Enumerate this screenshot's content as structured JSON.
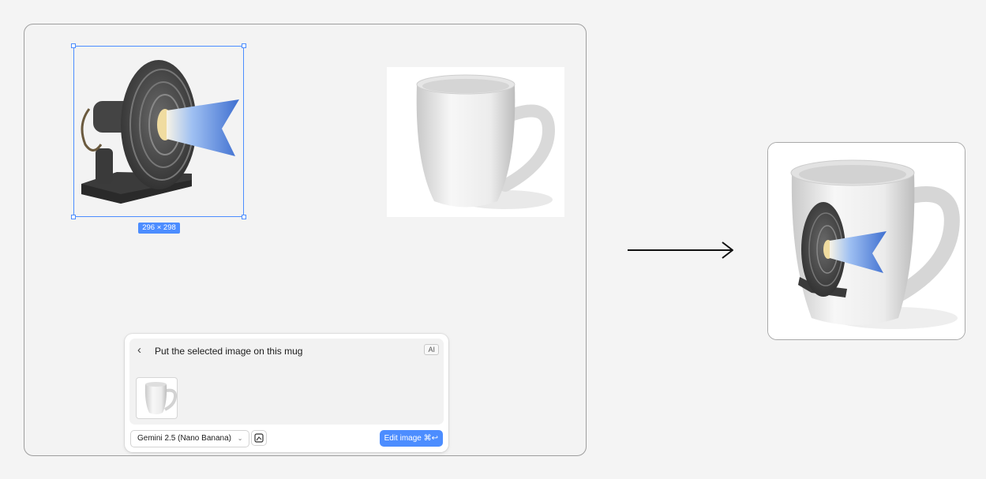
{
  "canvas": {
    "selected_image": {
      "icon": "projector-lens-icon",
      "size_label": "296 × 298"
    },
    "mug_image": {
      "icon": "white-mug-icon"
    }
  },
  "prompt_panel": {
    "back_icon": "chevron-left-icon",
    "back_glyph": "‹",
    "prompt": "Put the selected image on this mug",
    "ai_badge": "AI",
    "attachment_icon": "white-mug-icon",
    "model": "Gemini 2.5 (Nano Banana)",
    "model_chevron": "⌄",
    "tool_icon": "image-edit-icon",
    "edit_button": "Edit image ⌘↩",
    "accent_color": "#4c8dff"
  },
  "flow_arrow_icon": "arrow-right-icon",
  "result": {
    "icon": "mug-with-projector-icon"
  }
}
